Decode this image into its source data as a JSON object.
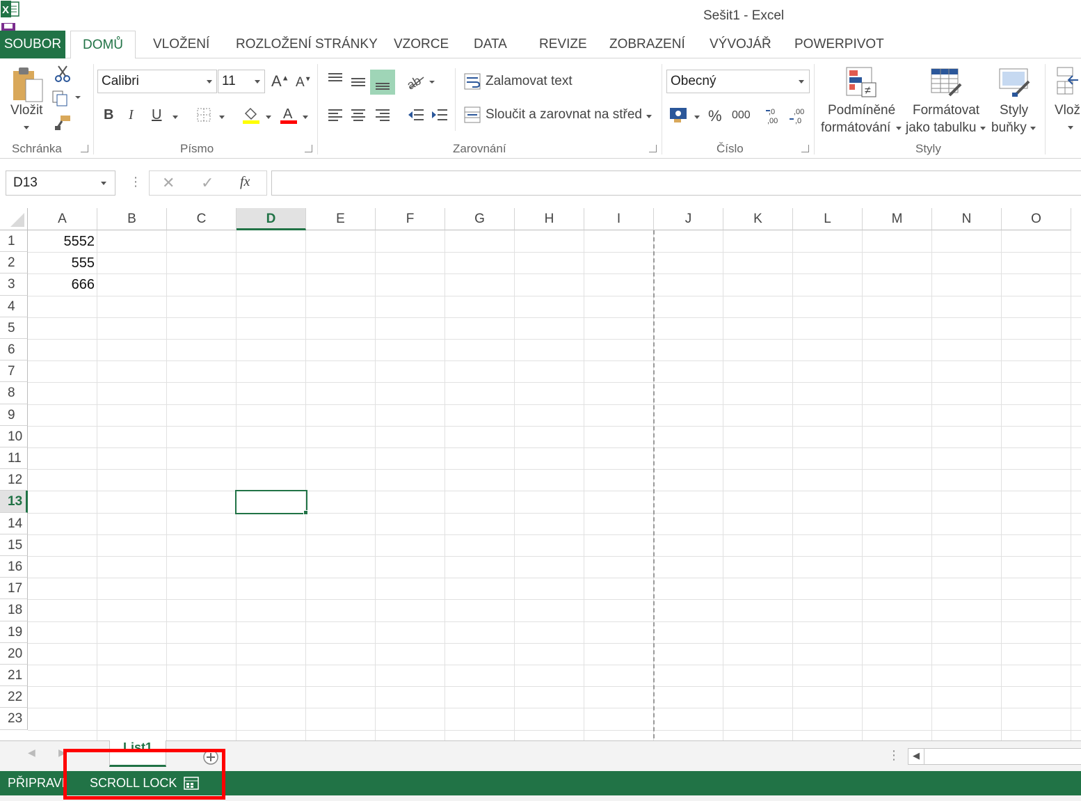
{
  "window": {
    "title": "Sešit1 - Excel"
  },
  "tabs": [
    "SOUBOR",
    "DOMŮ",
    "VLOŽENÍ",
    "ROZLOŽENÍ STRÁNKY",
    "VZORCE",
    "DATA",
    "REVIZE",
    "ZOBRAZENÍ",
    "VÝVOJÁŘ",
    "POWERPIVOT"
  ],
  "ribbon": {
    "clipboard": {
      "paste_label": "Vložit",
      "group_label": "Schránka"
    },
    "font": {
      "font_name": "Calibri",
      "font_size": "11",
      "group_label": "Písmo"
    },
    "alignment": {
      "wrap_text": "Zalamovat text",
      "merge_center": "Sloučit a zarovnat na střed",
      "group_label": "Zarovnání"
    },
    "number": {
      "format": "Obecný",
      "group_label": "Číslo"
    },
    "styles": {
      "conditional_line1": "Podmíněné",
      "conditional_line2": "formátování",
      "format_table_line1": "Formátovat",
      "format_table_line2": "jako tabulku",
      "cell_styles_line1": "Styly",
      "cell_styles_line2": "buňky",
      "group_label": "Styly"
    },
    "cells": {
      "insert_label": "Vloži"
    }
  },
  "formula_bar": {
    "name_box": "D13",
    "formula": ""
  },
  "grid": {
    "columns": [
      "A",
      "B",
      "C",
      "D",
      "E",
      "F",
      "G",
      "H",
      "I",
      "J",
      "K",
      "L",
      "M",
      "N",
      "O"
    ],
    "rows": [
      "1",
      "2",
      "3",
      "4",
      "5",
      "6",
      "7",
      "8",
      "9",
      "10",
      "11",
      "12",
      "13",
      "14",
      "15",
      "16",
      "17",
      "18",
      "19",
      "20",
      "21",
      "22",
      "23"
    ],
    "selected_cell": "D13",
    "cells": {
      "A1": "5552",
      "A2": "555",
      "A3": "666"
    }
  },
  "sheets": [
    "List1"
  ],
  "status": {
    "ready": "PŘIPRAVEN",
    "scroll_lock": "SCROLL LOCK"
  },
  "colors": {
    "excel_green": "#217346",
    "highlight_red": "#ff0000"
  },
  "icons": [
    "excel-logo-icon",
    "save-icon",
    "undo-icon",
    "redo-icon",
    "customize-qat-icon",
    "paste-icon",
    "cut-icon",
    "copy-icon",
    "format-painter-icon",
    "bold-icon",
    "italic-icon",
    "underline-icon",
    "borders-icon",
    "fill-color-icon",
    "font-color-icon",
    "increase-font-icon",
    "decrease-font-icon",
    "align-top-icon",
    "align-middle-icon",
    "align-bottom-icon",
    "orientation-icon",
    "align-left-icon",
    "align-center-icon",
    "align-right-icon",
    "decrease-indent-icon",
    "increase-indent-icon",
    "wrap-text-icon",
    "merge-icon",
    "accounting-icon",
    "percent-icon",
    "comma-icon",
    "increase-decimal-icon",
    "decrease-decimal-icon",
    "conditional-formatting-icon",
    "format-as-table-icon",
    "cell-styles-icon",
    "insert-cells-icon",
    "cancel-icon",
    "enter-icon",
    "function-icon",
    "new-sheet-icon",
    "page-layout-status-icon"
  ]
}
